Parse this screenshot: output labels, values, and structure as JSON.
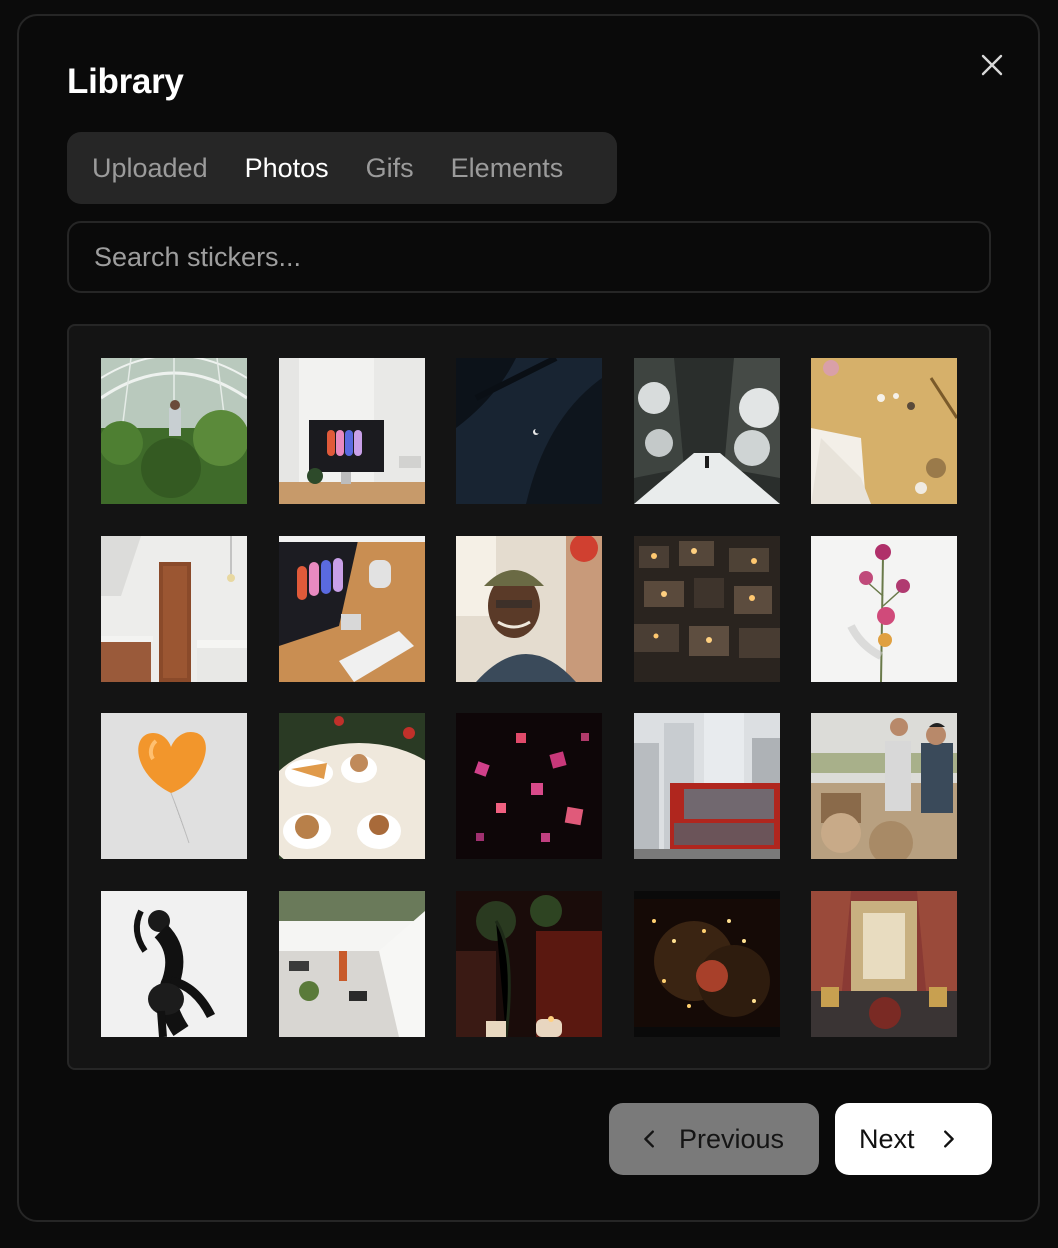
{
  "dialog": {
    "title": "Library",
    "close_icon": "close-icon"
  },
  "tabs": [
    {
      "label": "Uploaded",
      "active": false
    },
    {
      "label": "Photos",
      "active": true
    },
    {
      "label": "Gifs",
      "active": false
    },
    {
      "label": "Elements",
      "active": false
    }
  ],
  "search": {
    "placeholder": "Search stickers...",
    "value": ""
  },
  "photos": [
    {
      "name": "greenhouse-photo"
    },
    {
      "name": "desk-monitor-photo"
    },
    {
      "name": "palm-night-moon-photo"
    },
    {
      "name": "snowy-forest-path-photo"
    },
    {
      "name": "gold-envelope-flatlay-photo"
    },
    {
      "name": "white-kitchen-photo"
    },
    {
      "name": "desk-setup-topdown-photo"
    },
    {
      "name": "smiling-man-cap-photo"
    },
    {
      "name": "hillside-town-night-photo"
    },
    {
      "name": "pink-flowers-photo"
    },
    {
      "name": "orange-heart-balloon-photo"
    },
    {
      "name": "cookies-coffee-table-photo"
    },
    {
      "name": "floating-gifts-photo"
    },
    {
      "name": "city-red-bus-photo"
    },
    {
      "name": "couple-harvest-photo"
    },
    {
      "name": "dancer-bw-photo"
    },
    {
      "name": "street-balcony-photo"
    },
    {
      "name": "dark-plant-candles-photo"
    },
    {
      "name": "christmas-tree-film-photo"
    },
    {
      "name": "ornate-room-painting-photo"
    }
  ],
  "pagination": {
    "previous_label": "Previous",
    "next_label": "Next",
    "previous_icon": "chevron-left-icon",
    "next_icon": "chevron-right-icon"
  },
  "colors": {
    "background": "#0a0a0a",
    "surface": "#262626",
    "active_tab": "#ffffff",
    "inactive_tab": "#9b9b9b",
    "previous_button": "#7a7a7a",
    "next_button": "#ffffff"
  }
}
